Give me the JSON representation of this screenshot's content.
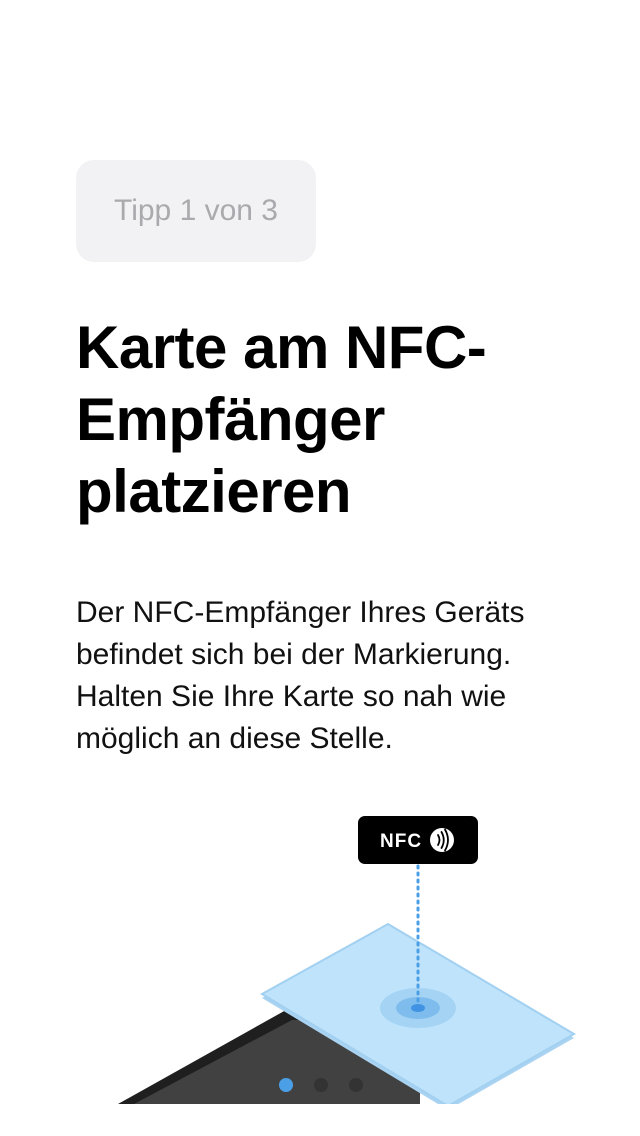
{
  "tip": {
    "label": "Tipp 1 von 3"
  },
  "title": {
    "lines": [
      "Karte am NFC-",
      "Empfänger",
      "platzieren"
    ]
  },
  "description": {
    "lines": [
      "Der NFC-Empfänger Ihres Geräts",
      "befindet sich bei der Markierung.",
      "Halten Sie Ihre Karte so nah wie",
      "möglich an diese Stelle."
    ]
  },
  "illustration": {
    "tag_label": "NFC",
    "tag_icon": "contactless-icon",
    "card_color": "#b9dff8",
    "marker_color": "#4a9fe6",
    "device_color": "#3f3f3f"
  },
  "pager": {
    "pages": 3,
    "current": 1,
    "active_color": "#4a9fe6",
    "inactive_color": "#333333"
  }
}
